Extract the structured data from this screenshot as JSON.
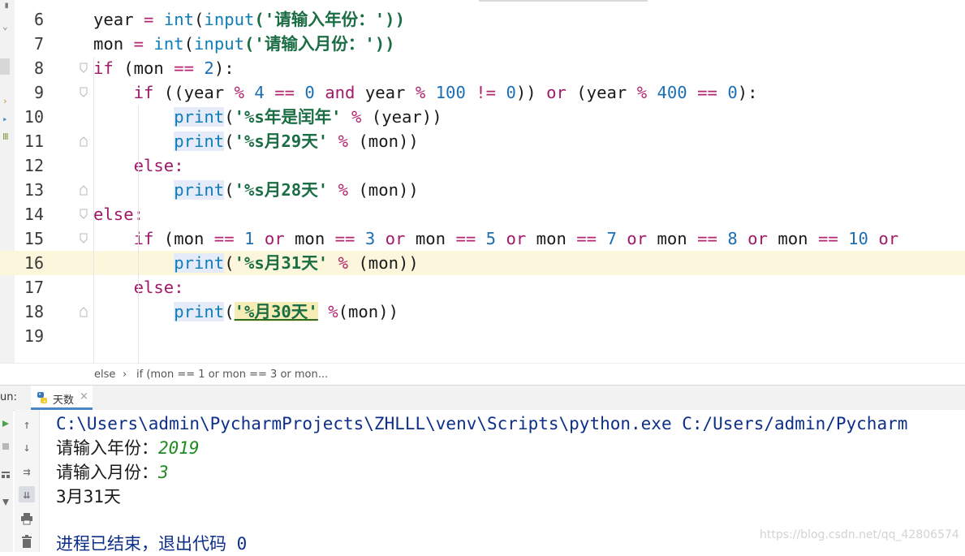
{
  "editor": {
    "current_line_number": "16",
    "lines": [
      {
        "n": "6",
        "tokens": [
          {
            "t": "year ",
            "c": "plain"
          },
          {
            "t": "= ",
            "c": "op"
          },
          {
            "t": "int",
            "c": "bi"
          },
          {
            "t": "(",
            "c": "plain"
          },
          {
            "t": "input",
            "c": "bi"
          },
          {
            "t": "('请输入年份：'))",
            "c": "str"
          }
        ]
      },
      {
        "n": "7",
        "tokens": [
          {
            "t": "mon ",
            "c": "plain"
          },
          {
            "t": "= ",
            "c": "op"
          },
          {
            "t": "int",
            "c": "bi"
          },
          {
            "t": "(",
            "c": "plain"
          },
          {
            "t": "input",
            "c": "bi"
          },
          {
            "t": "('请输入月份：'))",
            "c": "str"
          }
        ]
      },
      {
        "n": "8",
        "tokens": [
          {
            "t": "if ",
            "c": "kw"
          },
          {
            "t": "(mon ",
            "c": "plain"
          },
          {
            "t": "== ",
            "c": "op"
          },
          {
            "t": "2",
            "c": "num"
          },
          {
            "t": "):",
            "c": "plain"
          }
        ]
      },
      {
        "n": "9",
        "tokens": [
          {
            "t": "    if ",
            "c": "kw"
          },
          {
            "t": "((year ",
            "c": "plain"
          },
          {
            "t": "% ",
            "c": "op"
          },
          {
            "t": "4 ",
            "c": "num"
          },
          {
            "t": "== ",
            "c": "op"
          },
          {
            "t": "0 ",
            "c": "num"
          },
          {
            "t": "and ",
            "c": "kw"
          },
          {
            "t": "year ",
            "c": "plain"
          },
          {
            "t": "% ",
            "c": "op"
          },
          {
            "t": "100 ",
            "c": "num"
          },
          {
            "t": "!= ",
            "c": "op"
          },
          {
            "t": "0",
            "c": "num"
          },
          {
            "t": ")) ",
            "c": "plain"
          },
          {
            "t": "or ",
            "c": "kw"
          },
          {
            "t": "(year ",
            "c": "plain"
          },
          {
            "t": "% ",
            "c": "op"
          },
          {
            "t": "400 ",
            "c": "num"
          },
          {
            "t": "== ",
            "c": "op"
          },
          {
            "t": "0",
            "c": "num"
          },
          {
            "t": "):",
            "c": "plain"
          }
        ]
      },
      {
        "n": "10",
        "tokens": [
          {
            "t": "        ",
            "c": "plain"
          },
          {
            "t": "print",
            "c": "bi hl"
          },
          {
            "t": "(",
            "c": "plain"
          },
          {
            "t": "'%s年是闰年' ",
            "c": "str"
          },
          {
            "t": "% ",
            "c": "op"
          },
          {
            "t": "(year))",
            "c": "plain"
          }
        ]
      },
      {
        "n": "11",
        "tokens": [
          {
            "t": "        ",
            "c": "plain"
          },
          {
            "t": "print",
            "c": "bi hl"
          },
          {
            "t": "(",
            "c": "plain"
          },
          {
            "t": "'%s月29天' ",
            "c": "str"
          },
          {
            "t": "% ",
            "c": "op"
          },
          {
            "t": "(mon))",
            "c": "plain"
          }
        ]
      },
      {
        "n": "12",
        "tokens": [
          {
            "t": "    else:",
            "c": "kw"
          }
        ]
      },
      {
        "n": "13",
        "tokens": [
          {
            "t": "        ",
            "c": "plain"
          },
          {
            "t": "print",
            "c": "bi hl"
          },
          {
            "t": "(",
            "c": "plain"
          },
          {
            "t": "'%s月28天' ",
            "c": "str"
          },
          {
            "t": "% ",
            "c": "op"
          },
          {
            "t": "(mon))",
            "c": "plain"
          }
        ]
      },
      {
        "n": "14",
        "tokens": [
          {
            "t": "else:",
            "c": "kw"
          }
        ]
      },
      {
        "n": "15",
        "tokens": [
          {
            "t": "    if ",
            "c": "kw"
          },
          {
            "t": "(mon ",
            "c": "plain"
          },
          {
            "t": "== ",
            "c": "op"
          },
          {
            "t": "1 ",
            "c": "num"
          },
          {
            "t": "or ",
            "c": "kw"
          },
          {
            "t": "mon ",
            "c": "plain"
          },
          {
            "t": "== ",
            "c": "op"
          },
          {
            "t": "3 ",
            "c": "num"
          },
          {
            "t": "or ",
            "c": "kw"
          },
          {
            "t": "mon ",
            "c": "plain"
          },
          {
            "t": "== ",
            "c": "op"
          },
          {
            "t": "5 ",
            "c": "num"
          },
          {
            "t": "or ",
            "c": "kw"
          },
          {
            "t": "mon ",
            "c": "plain"
          },
          {
            "t": "== ",
            "c": "op"
          },
          {
            "t": "7 ",
            "c": "num"
          },
          {
            "t": "or ",
            "c": "kw"
          },
          {
            "t": "mon ",
            "c": "plain"
          },
          {
            "t": "== ",
            "c": "op"
          },
          {
            "t": "8 ",
            "c": "num"
          },
          {
            "t": "or ",
            "c": "kw"
          },
          {
            "t": "mon ",
            "c": "plain"
          },
          {
            "t": "== ",
            "c": "op"
          },
          {
            "t": "10 ",
            "c": "num"
          },
          {
            "t": "or",
            "c": "kw"
          }
        ]
      },
      {
        "n": "16",
        "tokens": [
          {
            "t": "        ",
            "c": "plain"
          },
          {
            "t": "print",
            "c": "bi hl"
          },
          {
            "t": "(",
            "c": "plain"
          },
          {
            "t": "'%s月31天' ",
            "c": "str"
          },
          {
            "t": "% ",
            "c": "op"
          },
          {
            "t": "(mon))",
            "c": "plain"
          }
        ]
      },
      {
        "n": "17",
        "tokens": [
          {
            "t": "    else:",
            "c": "kw"
          }
        ]
      },
      {
        "n": "18",
        "tokens": [
          {
            "t": "        ",
            "c": "plain"
          },
          {
            "t": "print",
            "c": "bi hl"
          },
          {
            "t": "(",
            "c": "plain"
          },
          {
            "t": "'%月30天'",
            "c": "str hl2"
          },
          {
            "t": " ",
            "c": "plain"
          },
          {
            "t": "%",
            "c": "op"
          },
          {
            "t": "(mon))",
            "c": "plain"
          }
        ]
      },
      {
        "n": "19",
        "tokens": []
      }
    ]
  },
  "breadcrumb": {
    "item1": "else",
    "separator": "›",
    "item2": "if (mon == 1 or mon == 3 or mon..."
  },
  "run_panel": {
    "label": "un:",
    "tab_label": "天数",
    "tab_close": "×",
    "console": {
      "command": "C:\\Users\\admin\\PycharmProjects\\ZHLLL\\venv\\Scripts\\python.exe C:/Users/admin/Pycharm",
      "prompt_year": "请输入年份：",
      "input_year": "2019",
      "prompt_month": "请输入月份：",
      "input_month": "3",
      "output": "3月31天",
      "exit_message": "进程已结束，退出代码 0"
    }
  },
  "watermark": "https://blog.csdn.net/qq_42806574",
  "colors": {
    "keyword": "#a01a6a",
    "builtin": "#0f7eb8",
    "operator": "#b3266f",
    "number": "#1d6fb3",
    "string": "#1b6e43",
    "current_line": "#fcf6dc",
    "console_path": "#0d2f8a",
    "console_input": "#1f8a1f",
    "tab_underline": "#4a86c8"
  },
  "icons": [
    "python-file-icon",
    "run-icon",
    "stop-icon",
    "scroll-up-icon",
    "scroll-down-icon",
    "soft-wrap-icon",
    "scroll-to-end-icon",
    "print-icon",
    "trash-icon",
    "fold-marker-icon"
  ]
}
